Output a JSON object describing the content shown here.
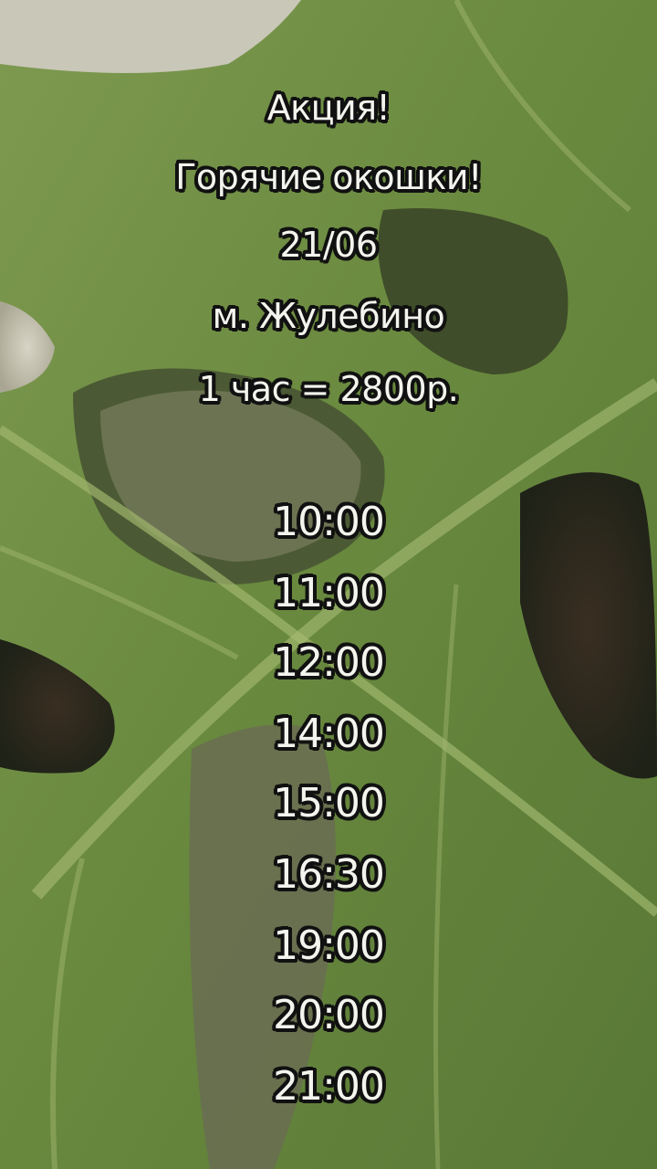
{
  "background": {
    "subject": "monstera-leaf-photo",
    "colors": {
      "leaf_light": "#8aa35a",
      "leaf_mid": "#5f7f3a",
      "leaf_dark": "#3d5a26",
      "hole_light": "#cfcbbd",
      "hole_dark": "#2a2a1e",
      "text_fill": "#f4f4ef",
      "text_outline": "#111111"
    }
  },
  "promo": {
    "title": "Акция!",
    "subtitle": "Горячие окошки!",
    "date": "21/06",
    "location": "м. Жулебино",
    "price": "1 час = 2800р."
  },
  "times": [
    "10:00",
    "11:00",
    "12:00",
    "14:00",
    "15:00",
    "16:30",
    "19:00",
    "20:00",
    "21:00"
  ]
}
